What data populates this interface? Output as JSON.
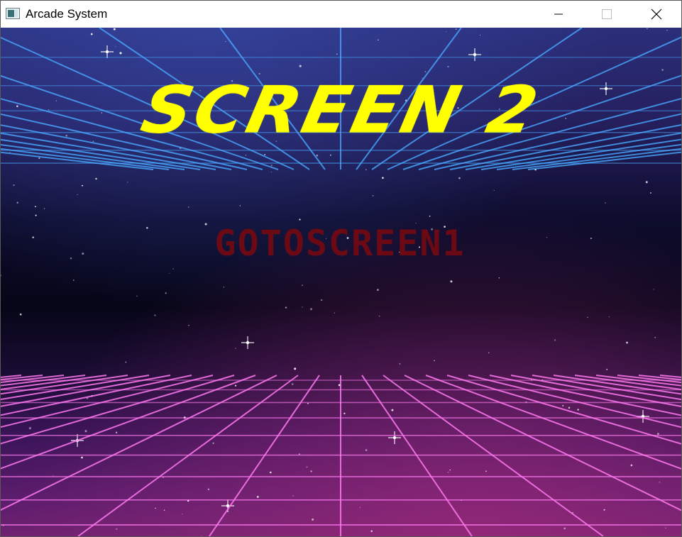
{
  "window": {
    "title": "Arcade System",
    "controls": {
      "minimize": "minimize-icon",
      "maximize": "maximize-icon",
      "close": "close-icon"
    }
  },
  "screen": {
    "title": "SCREEN 2",
    "button_label": "GOTOSCREEN1"
  },
  "colors": {
    "title": "#ffff00",
    "button_text": "#6b0a14",
    "grid_top": "#4aa8ff",
    "grid_bottom": "#ff79f0"
  }
}
